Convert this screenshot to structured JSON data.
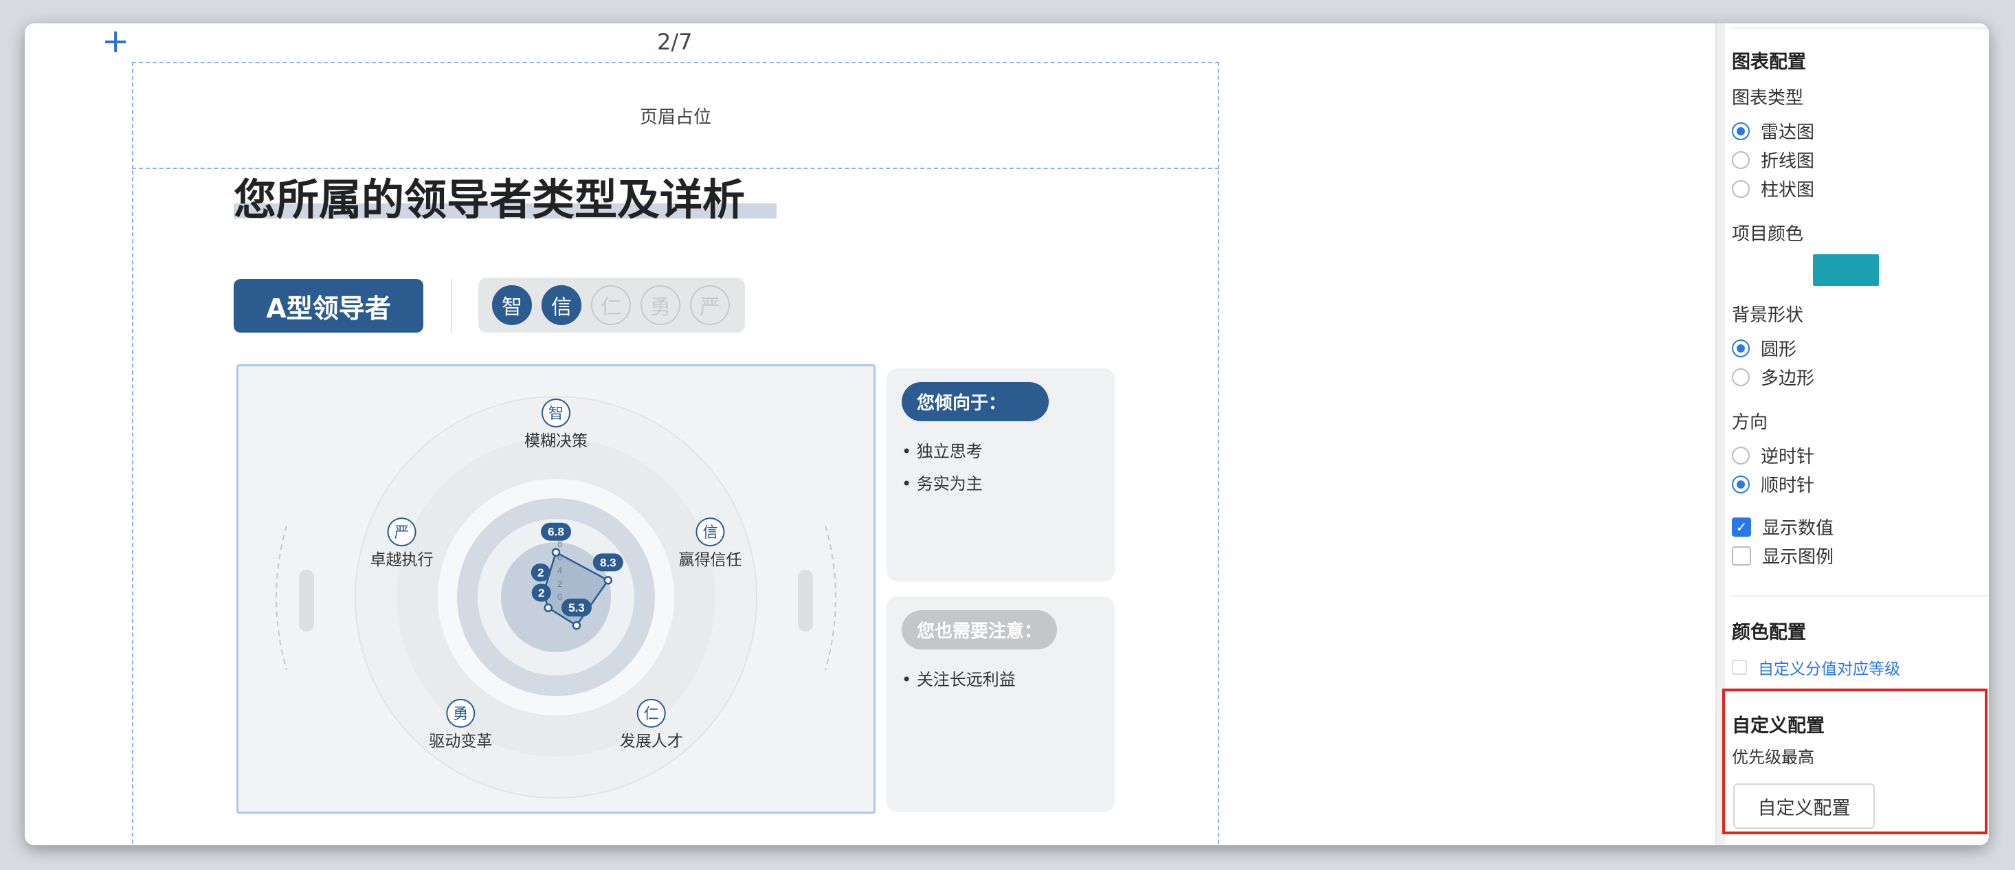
{
  "canvas": {
    "page_indicator": "2/7",
    "header_placeholder": "页眉占位",
    "title": "您所属的领导者类型及详析",
    "leader_badge": "A型领导者",
    "traits": [
      {
        "char": "智",
        "active": true
      },
      {
        "char": "信",
        "active": true
      },
      {
        "char": "仁",
        "active": false
      },
      {
        "char": "勇",
        "active": false
      },
      {
        "char": "严",
        "active": false
      }
    ]
  },
  "chart_data": {
    "type": "radar",
    "axes": [
      {
        "icon": "智",
        "label": "模糊决策",
        "value": 6.8
      },
      {
        "icon": "信",
        "label": "赢得信任",
        "value": 8.3
      },
      {
        "icon": "仁",
        "label": "发展人才",
        "value": 5.3
      },
      {
        "icon": "勇",
        "label": "驱动变革",
        "value": 2
      },
      {
        "icon": "严",
        "label": "卓越执行",
        "value": 2
      }
    ],
    "scale_ticks": [
      "0",
      "2",
      "4",
      "6",
      "8",
      "10"
    ],
    "range": [
      0,
      10
    ],
    "color": "#2b5b8f",
    "show_values": true
  },
  "info_cards": {
    "tendency_title": "您倾向于：",
    "tendency_items": [
      "独立思考",
      "务实为主"
    ],
    "attention_title": "您也需要注意：",
    "attention_items": [
      "关注长远利益"
    ]
  },
  "sidebar": {
    "chart_config_title": "图表配置",
    "chart_type_label": "图表类型",
    "chart_types": [
      "雷达图",
      "折线图",
      "柱状图"
    ],
    "chart_type_selected": 0,
    "item_color_label": "项目颜色",
    "item_color": "#1ba0b2",
    "bg_shape_label": "背景形状",
    "bg_shapes": [
      "圆形",
      "多边形"
    ],
    "bg_shape_selected": 0,
    "direction_label": "方向",
    "directions": [
      "逆时针",
      "顺时针"
    ],
    "direction_selected": 1,
    "show_values_label": "显示数值",
    "show_values": true,
    "show_legend_label": "显示图例",
    "show_legend": false,
    "color_config_title": "颜色配置",
    "custom_level_label": "自定义分值对应等级",
    "custom_config_title": "自定义配置",
    "priority_label": "优先级最高",
    "custom_config_button": "自定义配置"
  }
}
